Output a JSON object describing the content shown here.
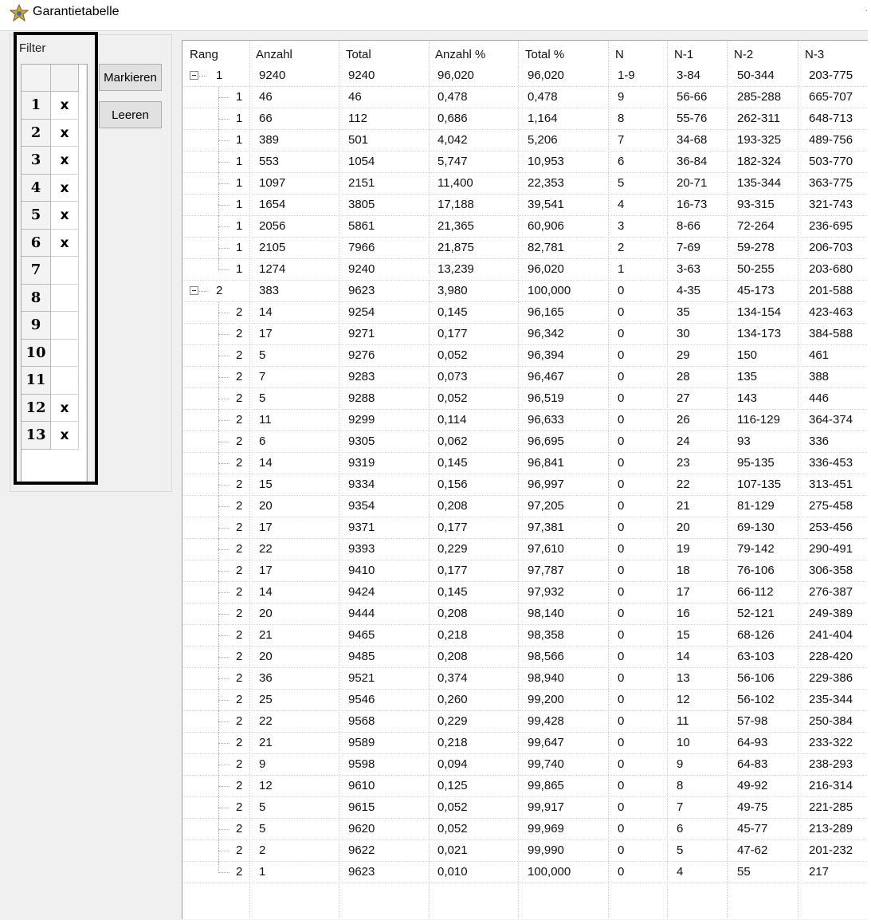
{
  "window": {
    "title": "Garantietabelle",
    "title_mark": "."
  },
  "filter": {
    "label": "Filter",
    "rows": [
      {
        "num": "1",
        "mark": "x"
      },
      {
        "num": "2",
        "mark": "x"
      },
      {
        "num": "3",
        "mark": "x"
      },
      {
        "num": "4",
        "mark": "x"
      },
      {
        "num": "5",
        "mark": "x"
      },
      {
        "num": "6",
        "mark": "x"
      },
      {
        "num": "7",
        "mark": ""
      },
      {
        "num": "8",
        "mark": ""
      },
      {
        "num": "9",
        "mark": ""
      },
      {
        "num": "10",
        "mark": ""
      },
      {
        "num": "11",
        "mark": ""
      },
      {
        "num": "12",
        "mark": "x"
      },
      {
        "num": "13",
        "mark": "x"
      }
    ]
  },
  "buttons": {
    "markieren": "Markieren",
    "leeren": "Leeren"
  },
  "table": {
    "columns": [
      "Rang",
      "Anzahl",
      "Total",
      "Anzahl %",
      "Total %",
      "N",
      "N-1",
      "N-2",
      "N-3"
    ],
    "rows": [
      {
        "level": 0,
        "rang": "1",
        "anzahl": "9240",
        "total": "9240",
        "anzahl_pct": "96,020",
        "total_pct": "96,020",
        "n": "1-9",
        "n1": "3-84",
        "n2": "50-344",
        "n3": "203-775"
      },
      {
        "level": 1,
        "rang": "1",
        "anzahl": "46",
        "total": "46",
        "anzahl_pct": "0,478",
        "total_pct": "0,478",
        "n": "9",
        "n1": "56-66",
        "n2": "285-288",
        "n3": "665-707"
      },
      {
        "level": 1,
        "rang": "1",
        "anzahl": "66",
        "total": "112",
        "anzahl_pct": "0,686",
        "total_pct": "1,164",
        "n": "8",
        "n1": "55-76",
        "n2": "262-311",
        "n3": "648-713"
      },
      {
        "level": 1,
        "rang": "1",
        "anzahl": "389",
        "total": "501",
        "anzahl_pct": "4,042",
        "total_pct": "5,206",
        "n": "7",
        "n1": "34-68",
        "n2": "193-325",
        "n3": "489-756"
      },
      {
        "level": 1,
        "rang": "1",
        "anzahl": "553",
        "total": "1054",
        "anzahl_pct": "5,747",
        "total_pct": "10,953",
        "n": "6",
        "n1": "36-84",
        "n2": "182-324",
        "n3": "503-770"
      },
      {
        "level": 1,
        "rang": "1",
        "anzahl": "1097",
        "total": "2151",
        "anzahl_pct": "11,400",
        "total_pct": "22,353",
        "n": "5",
        "n1": "20-71",
        "n2": "135-344",
        "n3": "363-775"
      },
      {
        "level": 1,
        "rang": "1",
        "anzahl": "1654",
        "total": "3805",
        "anzahl_pct": "17,188",
        "total_pct": "39,541",
        "n": "4",
        "n1": "16-73",
        "n2": "93-315",
        "n3": "321-743"
      },
      {
        "level": 1,
        "rang": "1",
        "anzahl": "2056",
        "total": "5861",
        "anzahl_pct": "21,365",
        "total_pct": "60,906",
        "n": "3",
        "n1": "8-66",
        "n2": "72-264",
        "n3": "236-695"
      },
      {
        "level": 1,
        "rang": "1",
        "anzahl": "2105",
        "total": "7966",
        "anzahl_pct": "21,875",
        "total_pct": "82,781",
        "n": "2",
        "n1": "7-69",
        "n2": "59-278",
        "n3": "206-703"
      },
      {
        "level": 1,
        "last": true,
        "rang": "1",
        "anzahl": "1274",
        "total": "9240",
        "anzahl_pct": "13,239",
        "total_pct": "96,020",
        "n": "1",
        "n1": "3-63",
        "n2": "50-255",
        "n3": "203-680"
      },
      {
        "level": 0,
        "rang": "2",
        "anzahl": "383",
        "total": "9623",
        "anzahl_pct": "3,980",
        "total_pct": "100,000",
        "n": "0",
        "n1": "4-35",
        "n2": "45-173",
        "n3": "201-588"
      },
      {
        "level": 1,
        "rang": "2",
        "anzahl": "14",
        "total": "9254",
        "anzahl_pct": "0,145",
        "total_pct": "96,165",
        "n": "0",
        "n1": "35",
        "n2": "134-154",
        "n3": "423-463"
      },
      {
        "level": 1,
        "rang": "2",
        "anzahl": "17",
        "total": "9271",
        "anzahl_pct": "0,177",
        "total_pct": "96,342",
        "n": "0",
        "n1": "30",
        "n2": "134-173",
        "n3": "384-588"
      },
      {
        "level": 1,
        "rang": "2",
        "anzahl": "5",
        "total": "9276",
        "anzahl_pct": "0,052",
        "total_pct": "96,394",
        "n": "0",
        "n1": "29",
        "n2": "150",
        "n3": "461"
      },
      {
        "level": 1,
        "rang": "2",
        "anzahl": "7",
        "total": "9283",
        "anzahl_pct": "0,073",
        "total_pct": "96,467",
        "n": "0",
        "n1": "28",
        "n2": "135",
        "n3": "388"
      },
      {
        "level": 1,
        "rang": "2",
        "anzahl": "5",
        "total": "9288",
        "anzahl_pct": "0,052",
        "total_pct": "96,519",
        "n": "0",
        "n1": "27",
        "n2": "143",
        "n3": "446"
      },
      {
        "level": 1,
        "rang": "2",
        "anzahl": "11",
        "total": "9299",
        "anzahl_pct": "0,114",
        "total_pct": "96,633",
        "n": "0",
        "n1": "26",
        "n2": "116-129",
        "n3": "364-374"
      },
      {
        "level": 1,
        "rang": "2",
        "anzahl": "6",
        "total": "9305",
        "anzahl_pct": "0,062",
        "total_pct": "96,695",
        "n": "0",
        "n1": "24",
        "n2": "93",
        "n3": "336"
      },
      {
        "level": 1,
        "rang": "2",
        "anzahl": "14",
        "total": "9319",
        "anzahl_pct": "0,145",
        "total_pct": "96,841",
        "n": "0",
        "n1": "23",
        "n2": "95-135",
        "n3": "336-453"
      },
      {
        "level": 1,
        "rang": "2",
        "anzahl": "15",
        "total": "9334",
        "anzahl_pct": "0,156",
        "total_pct": "96,997",
        "n": "0",
        "n1": "22",
        "n2": "107-135",
        "n3": "313-451"
      },
      {
        "level": 1,
        "rang": "2",
        "anzahl": "20",
        "total": "9354",
        "anzahl_pct": "0,208",
        "total_pct": "97,205",
        "n": "0",
        "n1": "21",
        "n2": "81-129",
        "n3": "275-458"
      },
      {
        "level": 1,
        "rang": "2",
        "anzahl": "17",
        "total": "9371",
        "anzahl_pct": "0,177",
        "total_pct": "97,381",
        "n": "0",
        "n1": "20",
        "n2": "69-130",
        "n3": "253-456"
      },
      {
        "level": 1,
        "rang": "2",
        "anzahl": "22",
        "total": "9393",
        "anzahl_pct": "0,229",
        "total_pct": "97,610",
        "n": "0",
        "n1": "19",
        "n2": "79-142",
        "n3": "290-491"
      },
      {
        "level": 1,
        "rang": "2",
        "anzahl": "17",
        "total": "9410",
        "anzahl_pct": "0,177",
        "total_pct": "97,787",
        "n": "0",
        "n1": "18",
        "n2": "76-106",
        "n3": "306-358"
      },
      {
        "level": 1,
        "rang": "2",
        "anzahl": "14",
        "total": "9424",
        "anzahl_pct": "0,145",
        "total_pct": "97,932",
        "n": "0",
        "n1": "17",
        "n2": "66-112",
        "n3": "276-387"
      },
      {
        "level": 1,
        "rang": "2",
        "anzahl": "20",
        "total": "9444",
        "anzahl_pct": "0,208",
        "total_pct": "98,140",
        "n": "0",
        "n1": "16",
        "n2": "52-121",
        "n3": "249-389"
      },
      {
        "level": 1,
        "rang": "2",
        "anzahl": "21",
        "total": "9465",
        "anzahl_pct": "0,218",
        "total_pct": "98,358",
        "n": "0",
        "n1": "15",
        "n2": "68-126",
        "n3": "241-404"
      },
      {
        "level": 1,
        "rang": "2",
        "anzahl": "20",
        "total": "9485",
        "anzahl_pct": "0,208",
        "total_pct": "98,566",
        "n": "0",
        "n1": "14",
        "n2": "63-103",
        "n3": "228-420"
      },
      {
        "level": 1,
        "rang": "2",
        "anzahl": "36",
        "total": "9521",
        "anzahl_pct": "0,374",
        "total_pct": "98,940",
        "n": "0",
        "n1": "13",
        "n2": "56-106",
        "n3": "229-386"
      },
      {
        "level": 1,
        "rang": "2",
        "anzahl": "25",
        "total": "9546",
        "anzahl_pct": "0,260",
        "total_pct": "99,200",
        "n": "0",
        "n1": "12",
        "n2": "56-102",
        "n3": "235-344"
      },
      {
        "level": 1,
        "rang": "2",
        "anzahl": "22",
        "total": "9568",
        "anzahl_pct": "0,229",
        "total_pct": "99,428",
        "n": "0",
        "n1": "11",
        "n2": "57-98",
        "n3": "250-384"
      },
      {
        "level": 1,
        "rang": "2",
        "anzahl": "21",
        "total": "9589",
        "anzahl_pct": "0,218",
        "total_pct": "99,647",
        "n": "0",
        "n1": "10",
        "n2": "64-93",
        "n3": "233-322"
      },
      {
        "level": 1,
        "rang": "2",
        "anzahl": "9",
        "total": "9598",
        "anzahl_pct": "0,094",
        "total_pct": "99,740",
        "n": "0",
        "n1": "9",
        "n2": "64-83",
        "n3": "238-293"
      },
      {
        "level": 1,
        "rang": "2",
        "anzahl": "12",
        "total": "9610",
        "anzahl_pct": "0,125",
        "total_pct": "99,865",
        "n": "0",
        "n1": "8",
        "n2": "49-92",
        "n3": "216-314"
      },
      {
        "level": 1,
        "rang": "2",
        "anzahl": "5",
        "total": "9615",
        "anzahl_pct": "0,052",
        "total_pct": "99,917",
        "n": "0",
        "n1": "7",
        "n2": "49-75",
        "n3": "221-285"
      },
      {
        "level": 1,
        "rang": "2",
        "anzahl": "5",
        "total": "9620",
        "anzahl_pct": "0,052",
        "total_pct": "99,969",
        "n": "0",
        "n1": "6",
        "n2": "45-77",
        "n3": "213-289"
      },
      {
        "level": 1,
        "rang": "2",
        "anzahl": "2",
        "total": "9622",
        "anzahl_pct": "0,021",
        "total_pct": "99,990",
        "n": "0",
        "n1": "5",
        "n2": "47-62",
        "n3": "201-232"
      },
      {
        "level": 1,
        "last": true,
        "rang": "2",
        "anzahl": "1",
        "total": "9623",
        "anzahl_pct": "0,010",
        "total_pct": "100,000",
        "n": "0",
        "n1": "4",
        "n2": "55",
        "n3": "217"
      }
    ]
  }
}
